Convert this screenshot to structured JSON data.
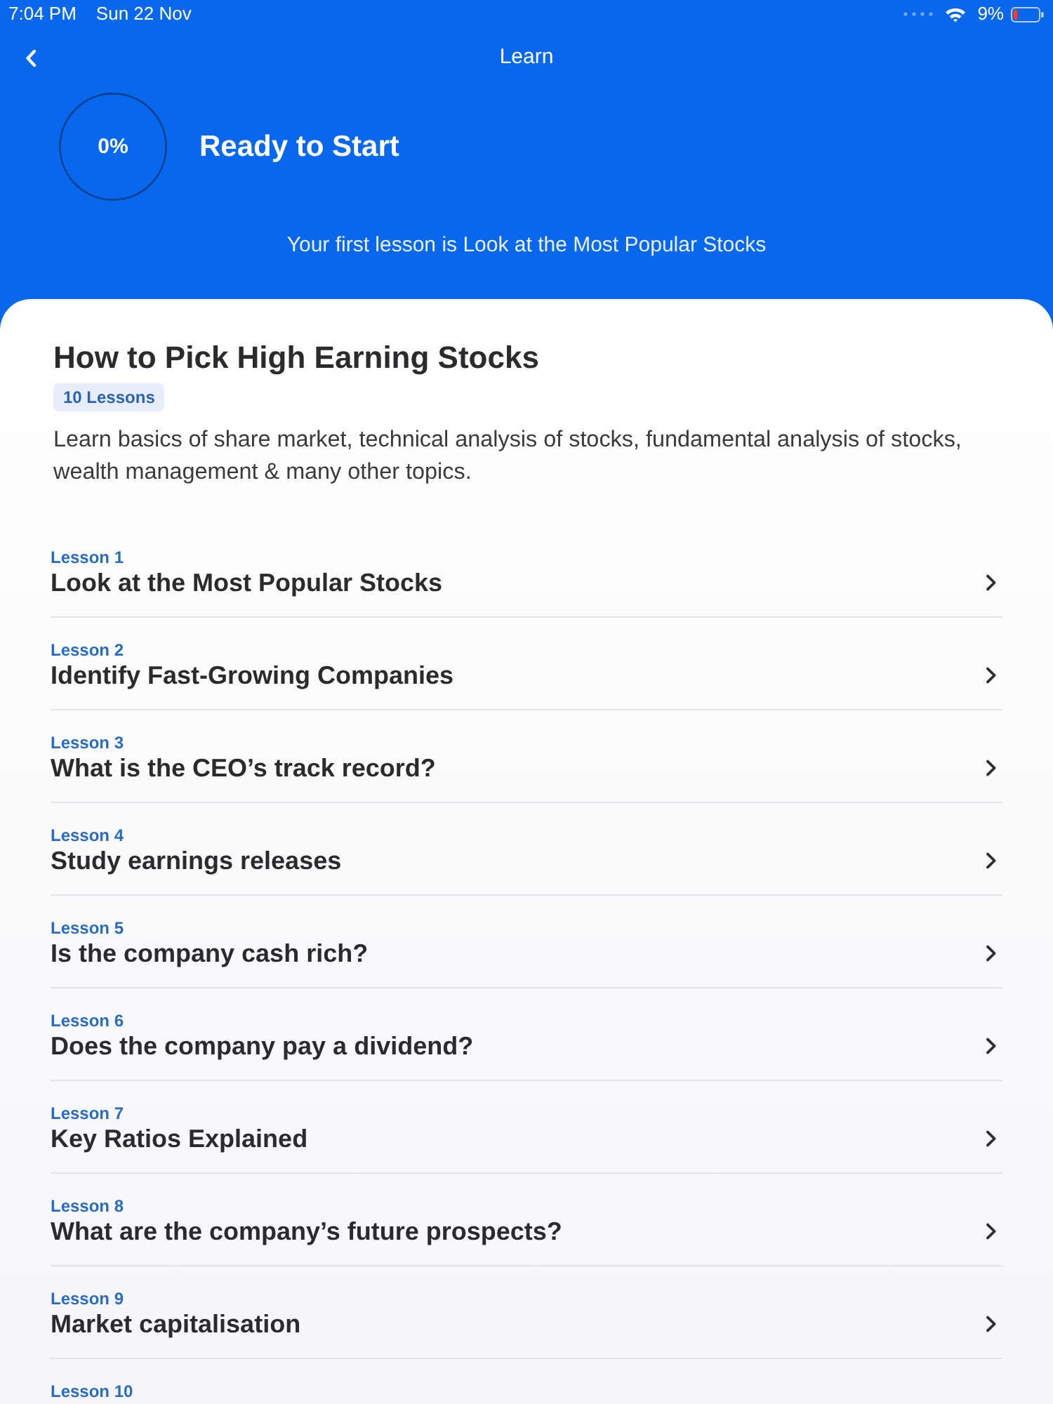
{
  "status_bar": {
    "time": "7:04 PM",
    "date": "Sun 22 Nov",
    "battery": "9%"
  },
  "nav": {
    "title": "Learn"
  },
  "progress": {
    "percent": "0%",
    "status": "Ready to Start",
    "next_lesson": "Your first lesson is Look at the Most Popular Stocks"
  },
  "course": {
    "title": "How to Pick High Earning Stocks",
    "badge": "10 Lessons",
    "description": "Learn basics of share market, technical analysis of stocks, fundamental analysis of stocks, wealth management & many other topics."
  },
  "lessons": [
    {
      "label": "Lesson 1",
      "title": "Look at the Most Popular Stocks"
    },
    {
      "label": "Lesson 2",
      "title": "Identify Fast-Growing Companies"
    },
    {
      "label": "Lesson 3",
      "title": "What is the CEO’s track record?"
    },
    {
      "label": "Lesson 4",
      "title": "Study earnings releases"
    },
    {
      "label": "Lesson 5",
      "title": "Is the company cash rich?"
    },
    {
      "label": "Lesson 6",
      "title": "Does the company pay a dividend?"
    },
    {
      "label": "Lesson 7",
      "title": "Key Ratios Explained"
    },
    {
      "label": "Lesson 8",
      "title": "What are the company’s future prospects?"
    },
    {
      "label": "Lesson 9",
      "title": "Market capitalisation"
    },
    {
      "label": "Lesson 10"
    }
  ]
}
